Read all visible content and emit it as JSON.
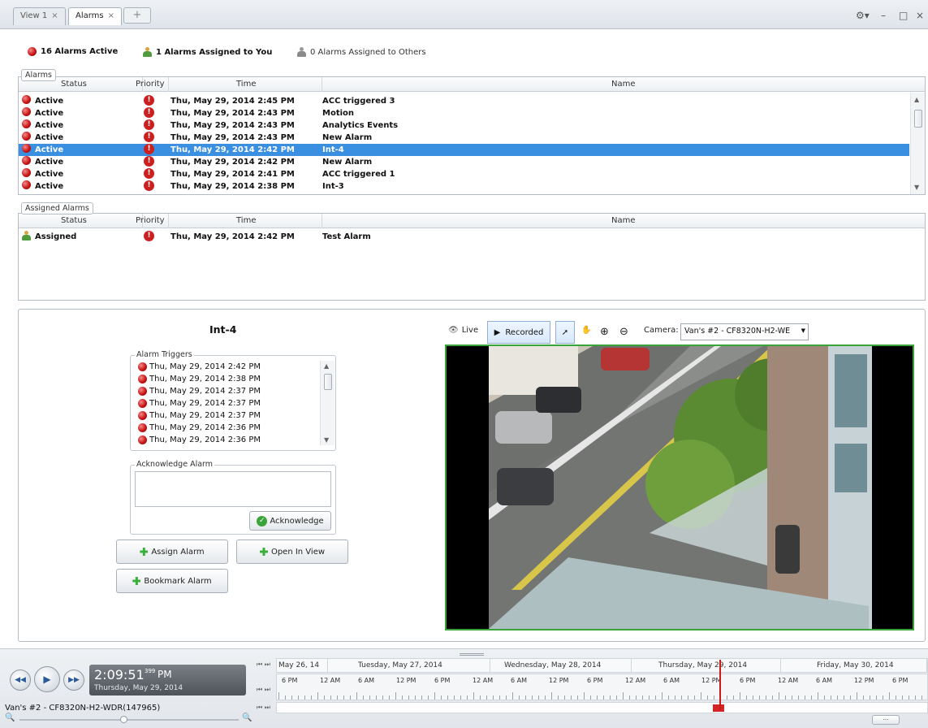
{
  "tabs": [
    {
      "label": "View 1",
      "close": "×"
    },
    {
      "label": "Alarms",
      "close": "×"
    }
  ],
  "tab_add_label": "+",
  "window_controls": {
    "settings": "⚙▾",
    "minimize": "–",
    "maximize": "□",
    "close": "×"
  },
  "summary": {
    "active": "16 Alarms Active",
    "assigned_to_you": "1 Alarms Assigned to You",
    "assigned_to_others": "0 Alarms Assigned to Others"
  },
  "alarms": {
    "label": "Alarms",
    "columns": {
      "status": "Status",
      "priority": "Priority",
      "time": "Time",
      "name": "Name"
    },
    "rows": [
      {
        "status": "Active",
        "priority": "!",
        "time": "Thu, May 29, 2014 2:45 PM",
        "name": "ACC triggered 3"
      },
      {
        "status": "Active",
        "priority": "!",
        "time": "Thu, May 29, 2014 2:43 PM",
        "name": "Motion"
      },
      {
        "status": "Active",
        "priority": "!",
        "time": "Thu, May 29, 2014 2:43 PM",
        "name": "Analytics Events"
      },
      {
        "status": "Active",
        "priority": "!",
        "time": "Thu, May 29, 2014 2:43 PM",
        "name": "New Alarm"
      },
      {
        "status": "Active",
        "priority": "!",
        "time": "Thu, May 29, 2014 2:42 PM",
        "name": "Int-4"
      },
      {
        "status": "Active",
        "priority": "!",
        "time": "Thu, May 29, 2014 2:42 PM",
        "name": "New Alarm"
      },
      {
        "status": "Active",
        "priority": "!",
        "time": "Thu, May 29, 2014 2:41 PM",
        "name": "ACC triggered 1"
      },
      {
        "status": "Active",
        "priority": "!",
        "time": "Thu, May 29, 2014 2:38 PM",
        "name": "Int-3"
      }
    ]
  },
  "assigned_alarms": {
    "label": "Assigned Alarms",
    "columns": {
      "status": "Status",
      "priority": "Priority",
      "time": "Time",
      "name": "Name"
    },
    "rows": [
      {
        "status": "Assigned",
        "priority": "!",
        "time": "Thu, May 29, 2014 2:42 PM",
        "name": "Test Alarm"
      }
    ]
  },
  "detail": {
    "title": "Int-4",
    "triggers_label": "Alarm Triggers",
    "triggers": [
      "Thu, May 29, 2014 2:42 PM",
      "Thu, May 29, 2014 2:38 PM",
      "Thu, May 29, 2014 2:37 PM",
      "Thu, May 29, 2014 2:37 PM",
      "Thu, May 29, 2014 2:37 PM",
      "Thu, May 29, 2014 2:36 PM",
      "Thu, May 29, 2014 2:36 PM"
    ],
    "acknowledge_label": "Acknowledge Alarm",
    "acknowledge_button": "Acknowledge",
    "assign_button": "Assign Alarm",
    "open_view_button": "Open In View",
    "bookmark_button": "Bookmark Alarm"
  },
  "video": {
    "live_label": "Live",
    "recorded_label": "Recorded",
    "camera_label": "Camera:",
    "camera_value": "Van's #2 - CF8320N-H2-WE"
  },
  "timeline": {
    "time": "2:09:51",
    "time_suffix": "399",
    "ampm": "PM",
    "date": "Thursday, May 29, 2014",
    "camera_name": "Van's #2 - CF8320N-H2-WDR(147965)",
    "days": [
      "May 26, 14",
      "Tuesday, May 27, 2014",
      "Wednesday, May 28, 2014",
      "Thursday, May 29, 2014",
      "Friday, May 30, 2014"
    ],
    "hours": [
      "6 PM",
      "12 AM",
      "6 AM",
      "12 PM",
      "6 PM",
      "12 AM",
      "6 AM",
      "12 PM",
      "6 PM",
      "12 AM",
      "6 AM",
      "12 PM",
      "6 PM",
      "12 AM",
      "6 AM",
      "12 PM",
      "6 PM"
    ],
    "colors": {
      "cursor": "#cc1a1a",
      "clock_bg": "#5e636a"
    }
  },
  "colors": {
    "selection": "#3a8fe0",
    "alarm_red": "#c81515",
    "video_border": "#3aa43a"
  }
}
